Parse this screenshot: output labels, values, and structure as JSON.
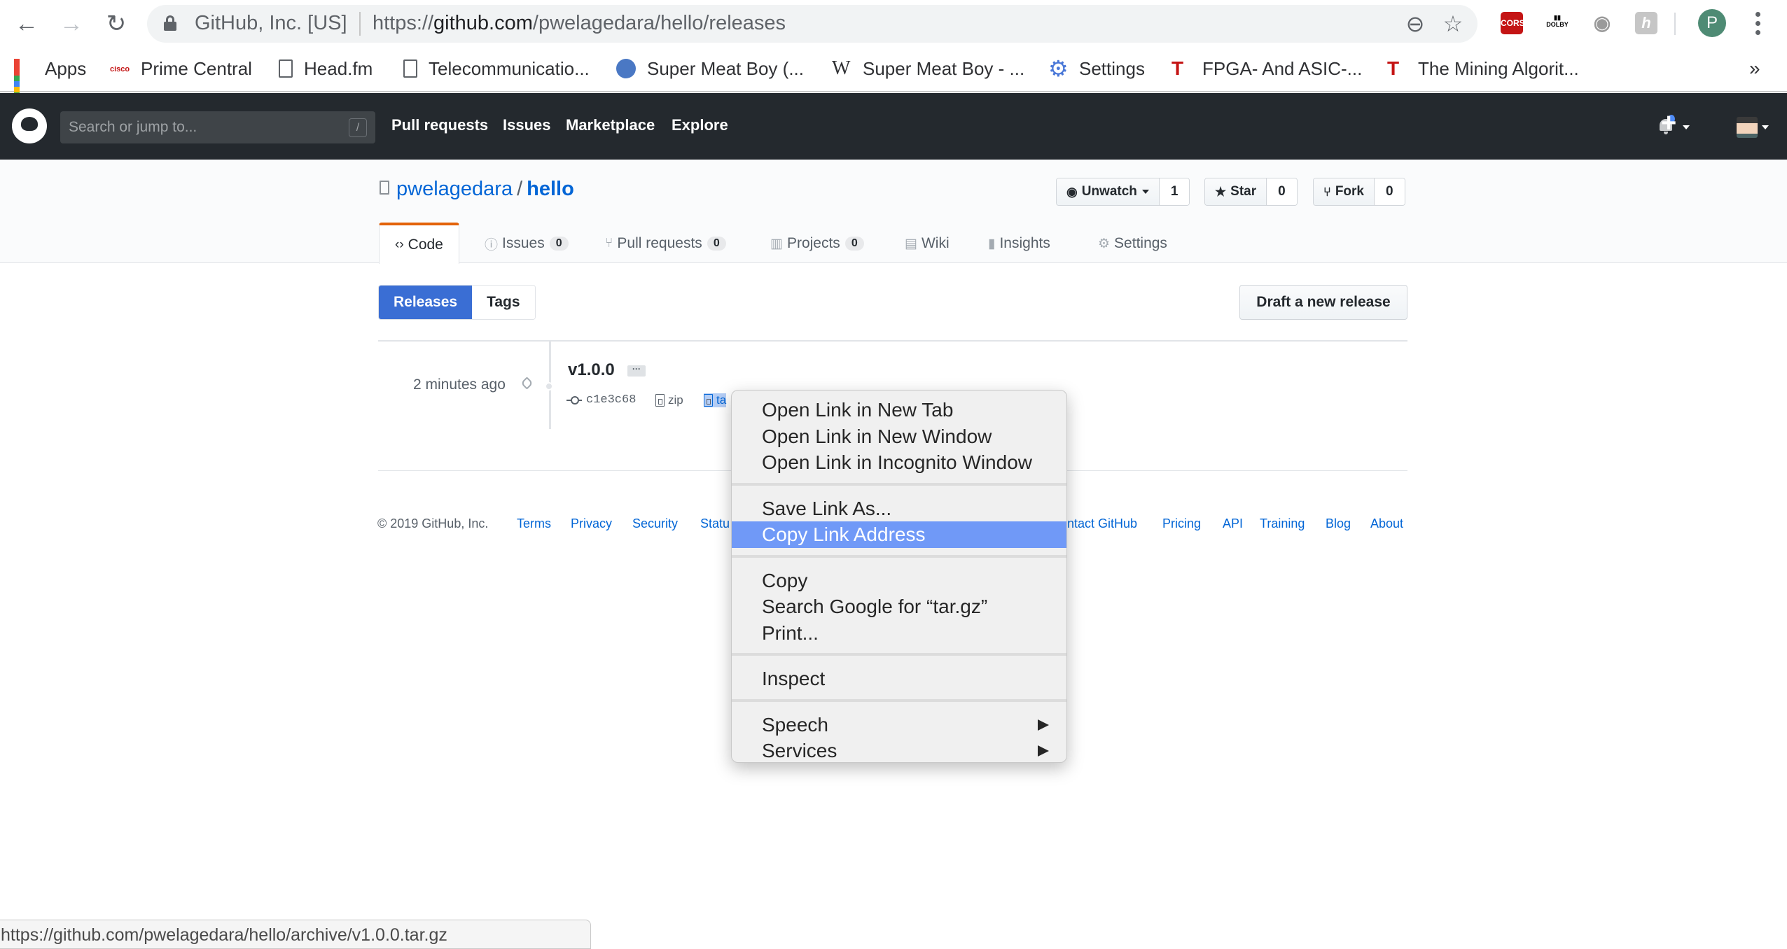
{
  "browser": {
    "site_identity": "GitHub, Inc. [US]",
    "url_prefix": "https://",
    "url_host": "github.com",
    "url_path": "/pwelagedara/hello/releases",
    "extensions": [
      "CORS",
      "Dolby Voice",
      "Camera",
      "h"
    ],
    "profile_initial": "P",
    "bookmarks": [
      {
        "label": "Apps",
        "icon": "apps-grid-icon"
      },
      {
        "label": "Prime Central",
        "icon": "cisco-icon"
      },
      {
        "label": "Head.fm",
        "icon": "page-icon"
      },
      {
        "label": "Telecommunicatio...",
        "icon": "page-icon"
      },
      {
        "label": "Super Meat Boy (...",
        "icon": "site-icon"
      },
      {
        "label": "Super Meat Boy - ...",
        "icon": "wikipedia-icon"
      },
      {
        "label": "Settings",
        "icon": "gear-icon"
      },
      {
        "label": "FPGA- And ASIC-...",
        "icon": "hammer-icon"
      },
      {
        "label": "The Mining Algorit...",
        "icon": "hammer-icon"
      }
    ],
    "bookmarks_overflow": "»",
    "status_url": "https://github.com/pwelagedara/hello/archive/v1.0.0.tar.gz"
  },
  "github_header": {
    "search_placeholder": "Search or jump to...",
    "search_shortcut": "/",
    "nav": [
      "Pull requests",
      "Issues",
      "Marketplace",
      "Explore"
    ],
    "plus": "+"
  },
  "repo": {
    "owner": "pwelagedara",
    "separator": "/",
    "name": "hello",
    "watch": {
      "label": "Unwatch",
      "count": "1"
    },
    "star": {
      "label": "Star",
      "count": "0"
    },
    "fork": {
      "label": "Fork",
      "count": "0"
    },
    "tabs": [
      {
        "label": "Code",
        "icon": "‹›"
      },
      {
        "label": "Issues",
        "count": "0",
        "icon": "ⓘ"
      },
      {
        "label": "Pull requests",
        "count": "0",
        "icon": "⑂"
      },
      {
        "label": "Projects",
        "count": "0",
        "icon": "▥"
      },
      {
        "label": "Wiki",
        "icon": "▤"
      },
      {
        "label": "Insights",
        "icon": "▮"
      },
      {
        "label": "Settings",
        "icon": "⚙"
      }
    ]
  },
  "releases": {
    "toggle": [
      "Releases",
      "Tags"
    ],
    "draft_button": "Draft a new release",
    "items": [
      {
        "time": "2 minutes ago",
        "title": "v1.0.0",
        "more": "···",
        "commit": "c1e3c68",
        "zip_label": "zip",
        "tar_label_visible": "ta"
      }
    ]
  },
  "footer": {
    "copyright": "© 2019 GitHub, Inc.",
    "links_left": [
      "Terms",
      "Privacy",
      "Security",
      "Statu"
    ],
    "links_right": [
      "ntact GitHub",
      "Pricing",
      "API",
      "Training",
      "Blog",
      "About"
    ]
  },
  "context_menu": {
    "groups": [
      [
        "Open Link in New Tab",
        "Open Link in New Window",
        "Open Link in Incognito Window"
      ],
      [
        "Save Link As...",
        "Copy Link Address"
      ],
      [
        "Copy",
        "Search Google for “tar.gz”",
        "Print..."
      ],
      [
        "Inspect"
      ],
      [
        "Speech",
        "Services"
      ]
    ],
    "highlighted": "Copy Link Address"
  }
}
